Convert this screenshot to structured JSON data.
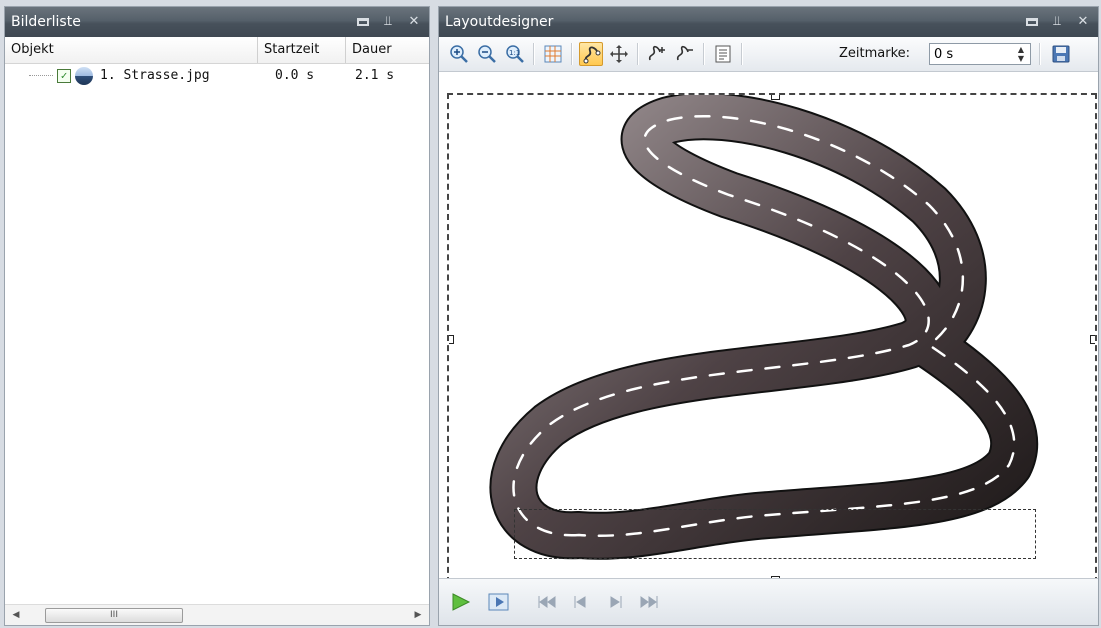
{
  "left_panel": {
    "title": "Bilderliste",
    "columns": {
      "object": "Objekt",
      "start": "Startzeit",
      "duration": "Dauer"
    },
    "rows": [
      {
        "name": "1. Strasse.jpg",
        "start": "0.0 s",
        "duration": "2.1 s",
        "checked": true,
        "check_mark": "✓"
      }
    ],
    "scroll_grip": "III"
  },
  "right_panel": {
    "title": "Layoutdesigner",
    "toolbar": {
      "zeitmarke_label": "Zeitmarke:",
      "zeitmarke_value": "0 s"
    }
  },
  "icons": {
    "window": "window-icon",
    "pin": "pin-icon",
    "close": "close-icon"
  },
  "colors": {
    "titlebar": "#4d5761",
    "road": "#5a4a47",
    "active_tool": "#ffc84f"
  }
}
